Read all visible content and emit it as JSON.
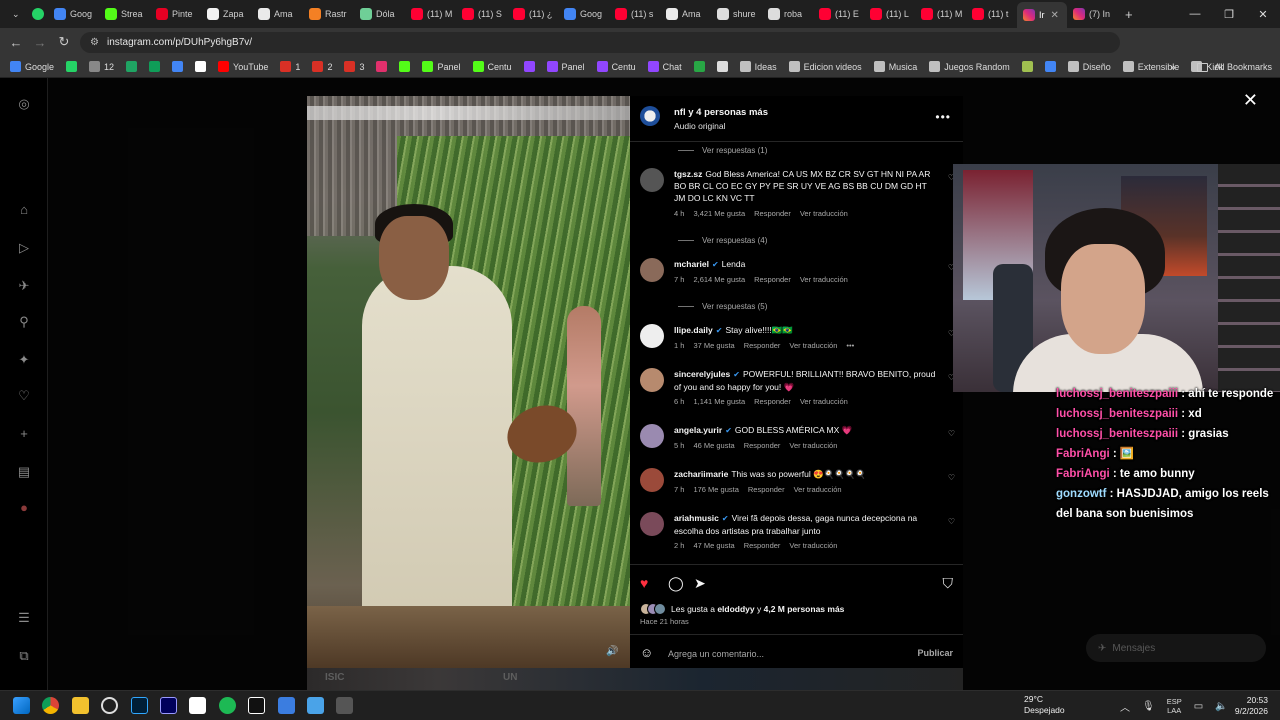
{
  "browser": {
    "tabs": [
      {
        "label": "Goog",
        "color": "#4285f4"
      },
      {
        "label": "Strea",
        "color": "#53fc18"
      },
      {
        "label": "Pinte",
        "color": "#e60023"
      },
      {
        "label": "Zapa",
        "color": "#f2f2f2"
      },
      {
        "label": "Ama",
        "color": "#eaeaea"
      },
      {
        "label": "Rastr",
        "color": "#f48024"
      },
      {
        "label": "Dóla",
        "color": "#6fcf97"
      },
      {
        "label": "(11) M",
        "color": "#ff0033"
      },
      {
        "label": "(11) S",
        "color": "#ff0033"
      },
      {
        "label": "(11) ¿",
        "color": "#ff0033"
      },
      {
        "label": "Goog",
        "color": "#4285f4"
      },
      {
        "label": "(11) s",
        "color": "#ff0033"
      },
      {
        "label": "Ama",
        "color": "#eaeaea"
      },
      {
        "label": "shure",
        "color": "#dddddd"
      },
      {
        "label": "roba",
        "color": "#dddddd"
      },
      {
        "label": "(11) E",
        "color": "#ff0033"
      },
      {
        "label": "(11) L",
        "color": "#ff0033"
      },
      {
        "label": "(11) M",
        "color": "#ff0033"
      },
      {
        "label": "(11) t",
        "color": "#ff0033"
      }
    ],
    "active_tab": {
      "label": "Ir",
      "close": "✕"
    },
    "last_tab": {
      "label": "(7) In"
    },
    "new_tab": "+",
    "url": "instagram.com/p/DUhPy6hgB7v/",
    "bookmarks": [
      {
        "label": "Google",
        "color": "#4285f4"
      },
      {
        "label": "",
        "color": "#25d366"
      },
      {
        "label": "12",
        "color": "#888888"
      },
      {
        "label": "",
        "color": "#1fa463"
      },
      {
        "label": "",
        "color": "#0f9d58"
      },
      {
        "label": "",
        "color": "#4285f4"
      },
      {
        "label": "",
        "color": "#ffffff"
      },
      {
        "label": "YouTube",
        "color": "#ff0000"
      },
      {
        "label": "1",
        "color": "#d93025"
      },
      {
        "label": "2",
        "color": "#d93025"
      },
      {
        "label": "3",
        "color": "#d93025"
      },
      {
        "label": "",
        "color": "#e1306c"
      },
      {
        "label": "",
        "color": "#53fc18"
      },
      {
        "label": "Panel",
        "color": "#53fc18"
      },
      {
        "label": "Centu",
        "color": "#53fc18"
      },
      {
        "label": "",
        "color": "#9146ff"
      },
      {
        "label": "Panel",
        "color": "#9146ff"
      },
      {
        "label": "Centu",
        "color": "#9146ff"
      },
      {
        "label": "Chat",
        "color": "#9146ff"
      },
      {
        "label": "",
        "color": "#28a745"
      },
      {
        "label": "",
        "color": "#dddddd"
      },
      {
        "label": "Ideas",
        "color": "#c0c0c0"
      },
      {
        "label": "Edicion videos",
        "color": "#c0c0c0"
      },
      {
        "label": "Musica",
        "color": "#c0c0c0"
      },
      {
        "label": "Juegos Random",
        "color": "#c0c0c0"
      },
      {
        "label": "",
        "color": "#a0c050"
      },
      {
        "label": "",
        "color": "#4285f4"
      },
      {
        "label": "Diseño",
        "color": "#c0c0c0"
      },
      {
        "label": "Extensible",
        "color": "#c0c0c0"
      },
      {
        "label": "Kick",
        "color": "#c0c0c0"
      }
    ],
    "bookmarks_more": "»",
    "all_bookmarks": "All Bookmarks"
  },
  "post": {
    "author": "nfl y 4 personas más",
    "audio": "Audio original",
    "more": "•••",
    "close": "✕",
    "comments": [
      {
        "type": "replies",
        "label": "Ver respuestas (1)"
      },
      {
        "type": "comment",
        "user": "tgsz.sz",
        "verified": false,
        "text": "God Bless America! CA US MX BZ CR SV GT HN NI PA AR BO BR CL CO EC GY PY PE SR UY VE AG BS BB CU DM GD HT JM DO LC KN VC TT",
        "time": "4 h",
        "likes": "3,421 Me gusta",
        "reply": "Responder",
        "translate": "Ver traducción",
        "color": "#555555"
      },
      {
        "type": "replies",
        "label": "Ver respuestas (4)"
      },
      {
        "type": "comment",
        "user": "mchariel",
        "verified": true,
        "text": "Lenda",
        "time": "7 h",
        "likes": "2,614 Me gusta",
        "reply": "Responder",
        "translate": "Ver traducción",
        "color": "#8a6a5a"
      },
      {
        "type": "replies",
        "label": "Ver respuestas (5)"
      },
      {
        "type": "comment",
        "user": "llipe.daily",
        "verified": true,
        "text": "Stay alive!!!!🇧🇷🇧🇷",
        "time": "1 h",
        "likes": "37 Me gusta",
        "reply": "Responder",
        "translate": "Ver traducción",
        "color": "#eeeeee",
        "more": "•••"
      },
      {
        "type": "comment",
        "user": "sincerelyjules",
        "verified": true,
        "text": "POWERFUL! BRILLIANT!! BRAVO BENITO, proud of you and so happy for you! 💗",
        "time": "6 h",
        "likes": "1,141 Me gusta",
        "reply": "Responder",
        "translate": "Ver traducción",
        "color": "#b78a6e"
      },
      {
        "type": "comment",
        "user": "angela.yurir",
        "verified": true,
        "text": "GOD BLESS AMÉRICA MX 💗",
        "time": "5 h",
        "likes": "46 Me gusta",
        "reply": "Responder",
        "translate": "Ver traducción",
        "color": "#9a8ab0"
      },
      {
        "type": "comment",
        "user": "zachariimarie",
        "verified": false,
        "text": "This was so powerful 😍🍳🍳🍳🍳",
        "time": "7 h",
        "likes": "176 Me gusta",
        "reply": "Responder",
        "translate": "Ver traducción",
        "color": "#9b4a3a"
      },
      {
        "type": "comment",
        "user": "ariahmusic",
        "verified": true,
        "text": "Virei fã depois dessa, gaga nunca decepciona na escolha dos artistas pra trabalhar junto",
        "time": "2 h",
        "likes": "47 Me gusta",
        "reply": "Responder",
        "translate": "Ver traducción",
        "color": "#7a4a5a"
      }
    ],
    "liked_by_prefix": "Les gusta a ",
    "liked_by_user": "eldoddyy",
    "liked_by_suffix": " y ",
    "liked_by_count": "4,2 M personas más",
    "time_ago": "Hace 21 horas",
    "comment_placeholder": "Agrega un comentario...",
    "publish": "Publicar"
  },
  "stream": {
    "chat": [
      {
        "user": "luchossj_beniteszpaiii",
        "text": ": ahí te responde",
        "user_color": "pink"
      },
      {
        "user": "luchossj_beniteszpaiii",
        "text": ": xd",
        "user_color": "pink"
      },
      {
        "user": "luchossj_beniteszpaiii",
        "text": ": grasias",
        "user_color": "pink"
      },
      {
        "user": "FabriAngi",
        "text": ": 🖼️",
        "user_color": "pink"
      },
      {
        "user": "FabriAngi",
        "text": ": te amo bunny",
        "user_color": "pink"
      },
      {
        "user": "gonzowtf",
        "text": ": HASJDJAD, amigo los reels del bana son buenisimos",
        "user_color": "blue"
      }
    ],
    "messages_label": "Mensajes",
    "strip_left": "ISIC",
    "strip_mid": "UN"
  },
  "taskbar": {
    "temperature": "29°C",
    "weather": "Despejado",
    "lang_top": "ESP",
    "lang_bottom": "LAA",
    "time": "20:53",
    "date": "9/2/2026"
  }
}
